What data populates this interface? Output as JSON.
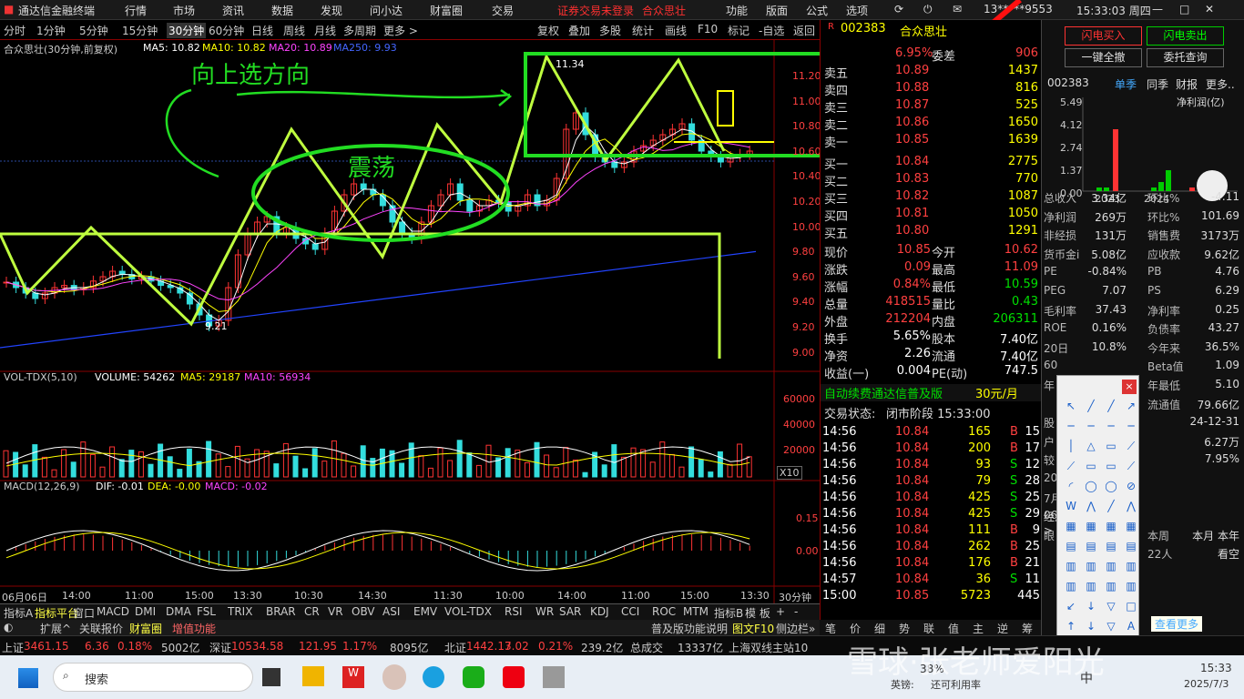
{
  "titlebar": {
    "app": "通达信金融终端",
    "menus": [
      "行情",
      "市场",
      "资讯",
      "数据",
      "发现",
      "问小达",
      "财富圈",
      "交易"
    ],
    "warning": "证券交易未登录",
    "stock": "合众思壮",
    "right_menus": [
      "功能",
      "版面",
      "公式",
      "选项"
    ],
    "account": "13*****9553",
    "time": "15:33:03 周四"
  },
  "periods": [
    "分时",
    "1分钟",
    "5分钟",
    "15分钟",
    "30分钟",
    "60分钟",
    "日线",
    "周线",
    "月线",
    "多周期",
    "更多 >"
  ],
  "selected_period": "30分钟",
  "toolbar": [
    "复权",
    "叠加",
    "多股",
    "统计",
    "画线",
    "F10",
    "标记",
    "-自选",
    "返回"
  ],
  "chart": {
    "header": "合众思壮(30分钟,前复权)",
    "ma5": "MA5: 10.82",
    "ma10": "MA10: 10.82",
    "ma20": "MA20: 10.89",
    "ma250": "MA250: 9.93",
    "annot_direction": "向上选方向",
    "annot_oscillate": "震荡",
    "high_label": "11.34",
    "low_label": "9.21",
    "y_ticks": [
      "11.20",
      "11.00",
      "10.80",
      "10.60",
      "10.40",
      "10.20",
      "10.00",
      "9.80",
      "9.60",
      "9.40",
      "9.20",
      "9.00"
    ],
    "vol_header": "VOL-TDX(5,10)",
    "vol_value": "VOLUME: 54262",
    "vol_ma5": "MA5: 29187",
    "vol_ma10": "MA10: 56934",
    "vol_ticks": [
      "60000",
      "40000",
      "20000"
    ],
    "vol_unit": "X10",
    "macd_header": "MACD(12,26,9)",
    "dif": "DIF: -0.01",
    "dea": "DEA: -0.00",
    "macd": "MACD: -0.02",
    "macd_ticks": [
      "0.15",
      "0.00"
    ],
    "x_labels": [
      "06月06日",
      "14:00",
      "11:00",
      "15:00",
      "13:30",
      "10:30",
      "14:30",
      "11:30",
      "10:00",
      "14:00",
      "11:00",
      "15:00",
      "13:30"
    ],
    "period_label": "30分钟"
  },
  "chart_data": {
    "type": "line",
    "title": "合众思壮(30分钟,前复权)",
    "ylim": [
      9.0,
      11.3
    ],
    "series": [
      {
        "name": "MA250",
        "values": [
          9.05,
          9.93
        ]
      }
    ],
    "high": 11.34,
    "low": 9.21
  },
  "quote": {
    "code": "002383",
    "name": "合众思壮",
    "weibi": "6.95%",
    "weicha_label": "委差",
    "weicha": "906",
    "asks": [
      {
        "label": "卖五",
        "price": "10.89",
        "vol": "1437"
      },
      {
        "label": "卖四",
        "price": "10.88",
        "vol": "816"
      },
      {
        "label": "卖三",
        "price": "10.87",
        "vol": "525"
      },
      {
        "label": "卖二",
        "price": "10.86",
        "vol": "1650"
      },
      {
        "label": "卖一",
        "price": "10.85",
        "vol": "1639"
      }
    ],
    "bids": [
      {
        "label": "买一",
        "price": "10.84",
        "vol": "2775"
      },
      {
        "label": "买二",
        "price": "10.83",
        "vol": "770"
      },
      {
        "label": "买三",
        "price": "10.82",
        "vol": "1087"
      },
      {
        "label": "买四",
        "price": "10.81",
        "vol": "1050"
      },
      {
        "label": "买五",
        "price": "10.80",
        "vol": "1291"
      }
    ],
    "stats": [
      {
        "l1": "现价",
        "v1": "10.85",
        "l2": "今开",
        "v2": "10.62"
      },
      {
        "l1": "涨跌",
        "v1": "0.09",
        "l2": "最高",
        "v2": "11.09"
      },
      {
        "l1": "涨幅",
        "v1": "0.84%",
        "l2": "最低",
        "v2": "10.59"
      },
      {
        "l1": "总量",
        "v1": "418515",
        "l2": "量比",
        "v2": "0.43"
      },
      {
        "l1": "外盘",
        "v1": "212204",
        "l2": "内盘",
        "v2": "206311"
      },
      {
        "l1": "换手",
        "v1": "5.65%",
        "l2": "股本",
        "v2": "7.40亿"
      },
      {
        "l1": "净资",
        "v1": "2.26",
        "l2": "流通",
        "v2": "7.40亿"
      },
      {
        "l1": "收益(一)",
        "v1": "0.004",
        "l2": "PE(动)",
        "v2": "747.5"
      }
    ],
    "ad": "自动续费通达信普及版",
    "ad_price": "30元/月",
    "status_label": "交易状态:",
    "status": "闭市阶段 15:33:00"
  },
  "ticks": [
    {
      "t": "14:56",
      "p": "10.84",
      "v": "165",
      "s": "B",
      "n": "15"
    },
    {
      "t": "14:56",
      "p": "10.84",
      "v": "200",
      "s": "B",
      "n": "17"
    },
    {
      "t": "14:56",
      "p": "10.84",
      "v": "93",
      "s": "S",
      "n": "12"
    },
    {
      "t": "14:56",
      "p": "10.84",
      "v": "79",
      "s": "S",
      "n": "28"
    },
    {
      "t": "14:56",
      "p": "10.84",
      "v": "425",
      "s": "S",
      "n": "25"
    },
    {
      "t": "14:56",
      "p": "10.84",
      "v": "425",
      "s": "S",
      "n": "29"
    },
    {
      "t": "14:56",
      "p": "10.84",
      "v": "111",
      "s": "B",
      "n": "9"
    },
    {
      "t": "14:56",
      "p": "10.84",
      "v": "262",
      "s": "B",
      "n": "25"
    },
    {
      "t": "14:56",
      "p": "10.84",
      "v": "176",
      "s": "B",
      "n": "21"
    },
    {
      "t": "14:57",
      "p": "10.84",
      "v": "36",
      "s": "S",
      "n": "11"
    },
    {
      "t": "15:00",
      "p": "10.85",
      "v": "5723",
      "s": "",
      "n": "445"
    }
  ],
  "far": {
    "buy": "闪电买入",
    "sell": "闪电卖出",
    "cancel": "一键全撤",
    "query": "委托查询",
    "code": "002383",
    "tabs": [
      "单季",
      "同季",
      "财报",
      "更多.."
    ],
    "profit": "净利润(亿)",
    "bar_ticks": [
      "5.49",
      "4.12",
      "2.74",
      "1.37",
      "0.00"
    ],
    "bar_years": [
      "2023",
      "2024"
    ],
    "rows": [
      {
        "a": "总收入",
        "b": "3.34亿",
        "c": "环比%",
        "d": "-4.11"
      },
      {
        "a": "净利润",
        "b": "269万",
        "c": "环比%",
        "d": "101.69"
      },
      {
        "a": "非经损",
        "b": "131万",
        "c": "销售费",
        "d": "3173万"
      },
      {
        "a": "货币金i",
        "b": "5.08亿",
        "c": "应收款",
        "d": "9.62亿"
      },
      {
        "a": "PE",
        "b": "-0.84%",
        "c": "PB",
        "d": "4.76"
      },
      {
        "a": "PEG",
        "b": "7.07",
        "c": "PS",
        "d": "6.29"
      },
      {
        "a": "毛利率",
        "b": "37.43",
        "c": "净利率",
        "d": "0.25"
      },
      {
        "a": "ROE",
        "b": "0.16%",
        "c": "负债率",
        "d": "43.27"
      },
      {
        "a": "20日",
        "b": "10.8%",
        "c": "今年来",
        "d": "36.5%"
      },
      {
        "a": "60",
        "b": "",
        "c": "Beta值",
        "d": "1.09"
      },
      {
        "a": "年",
        "b": "",
        "c": "年最低",
        "d": "5.10"
      },
      {
        "a": "",
        "b": "",
        "c": "流通值",
        "d": "79.66亿"
      },
      {
        "a": "股",
        "b": "03-31",
        "c": "",
        "d": "24-12-31"
      },
      {
        "a": "户",
        "b": "16万",
        "c": "",
        "d": "6.27万"
      },
      {
        "a": "较",
        "b": "81%",
        "c": "",
        "d": "7.95%"
      },
      {
        "a": "20",
        "b": "20日披露",
        "c": "",
        "d": ""
      },
      {
        "a": "7月",
        "b": "1795.02万",
        "c": "",
        "d": ""
      },
      {
        "a": "06",
        "b": "经济+北斗导航>",
        "c": "",
        "d": ""
      },
      {
        "a": "眼",
        "b": "",
        "c": "本周",
        "d": "本月 本年"
      },
      {
        "a": "",
        "b": "",
        "c": "22人",
        "d": "看空"
      }
    ],
    "more": "查看更多"
  },
  "bottom_tabs": [
    "指标A",
    "指标平台",
    "窗口",
    "MACD",
    "DMI",
    "DMA",
    "FSL",
    "TRIX",
    "BRAR",
    "CR",
    "VR",
    "OBV",
    "ASI",
    "EMV",
    "VOL-TDX",
    "RSI",
    "WR",
    "SAR",
    "KDJ",
    "CCI",
    "ROC",
    "MTM",
    "指标B",
    "模 板",
    "+",
    "-"
  ],
  "bar2": [
    "扩展^",
    "关联报价",
    "财富圈",
    "增值功能"
  ],
  "bar2_right": [
    "普及版功能说明",
    "图文F10",
    "侧边栏»"
  ],
  "rtabs": [
    "笔",
    "价",
    "细",
    "势",
    "联",
    "值",
    "主",
    "逆",
    "筹"
  ],
  "status": {
    "sh_label": "上证",
    "sh": "3461.15",
    "sh_chg": "6.36",
    "sh_pct": "0.18%",
    "sh_amt": "5002亿",
    "sz_label": "深证",
    "sz": "10534.58",
    "sz_chg": "121.95",
    "sz_pct": "1.17%",
    "sz_amt": "8095亿",
    "bz_label": "北证",
    "bz": "1442.17",
    "bz_chg": "3.02",
    "bz_pct": "0.21%",
    "bz_amt": "239.2亿",
    "total_label": "总成交",
    "total": "13337亿",
    "station": "上海双线主站10"
  },
  "taskbar": {
    "search": "搜索",
    "weather": "38%",
    "weather_note": "英镑:",
    "weather_note2": "还可利用率",
    "ime": "中",
    "time": "15:33",
    "date": "2025/7/3"
  },
  "watermark": "雪球·张老师爱阳光"
}
